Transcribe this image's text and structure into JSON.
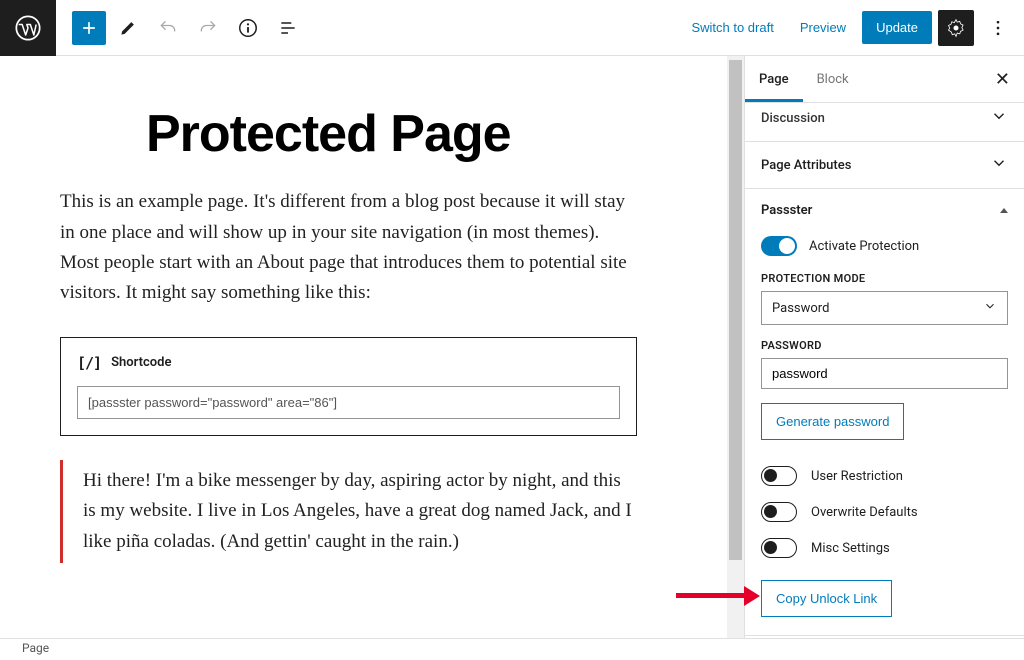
{
  "topbar": {
    "switch_draft": "Switch to draft",
    "preview": "Preview",
    "update": "Update"
  },
  "editor": {
    "title": "Protected Page",
    "intro": "This is an example page. It's different from a blog post because it will stay in one place and will show up in your site navigation (in most themes). Most people start with an About page that introduces them to potential site visitors. It might say something like this:",
    "shortcode_label": "Shortcode",
    "shortcode_value": "[passster password=\"password\" area=\"86\"]",
    "quote": "Hi there! I'm a bike messenger by day, aspiring actor by night, and this is my website. I live in Los Angeles, have a great dog named Jack, and I like piña coladas. (And gettin' caught in the rain.)"
  },
  "sidebar": {
    "tabs": {
      "page": "Page",
      "block": "Block"
    },
    "panels": {
      "discussion": "Discussion",
      "page_attributes": "Page Attributes"
    },
    "passster": {
      "heading": "Passster",
      "activate_label": "Activate Protection",
      "mode_label": "PROTECTION MODE",
      "mode_value": "Password",
      "password_label": "PASSWORD",
      "password_value": "password",
      "generate_btn": "Generate password",
      "user_restriction": "User Restriction",
      "overwrite_defaults": "Overwrite Defaults",
      "misc_settings": "Misc Settings",
      "copy_link_btn": "Copy Unlock Link"
    }
  },
  "footer": {
    "breadcrumb": "Page"
  }
}
